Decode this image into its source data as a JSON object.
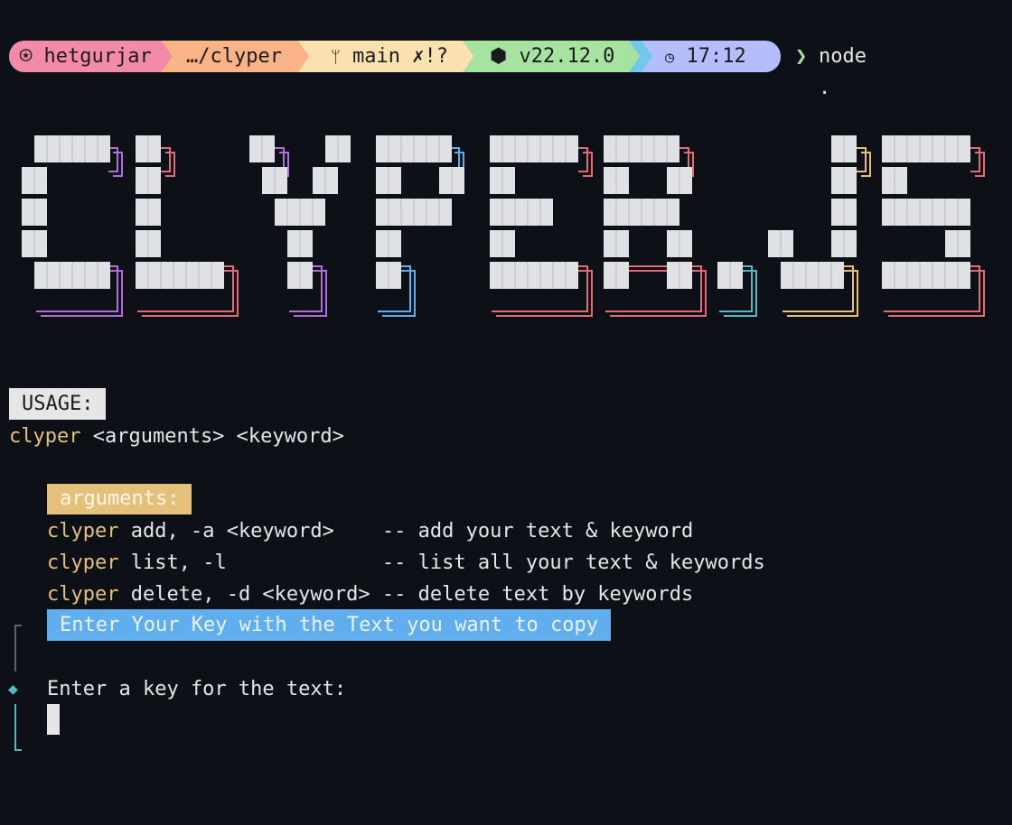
{
  "prompt": {
    "user_icon": "arch-icon",
    "user": "hetgurjar",
    "path": "…/clyper",
    "git_icon": "branch-icon",
    "git_branch": "main",
    "git_status": "✗!?",
    "node_icon": "node-icon",
    "node_version": "v22.12.0",
    "time_icon": "clock-icon",
    "time": "17:12",
    "prompt_char": "❯",
    "command": "node ."
  },
  "banner": {
    "text": "CLYPER.JS"
  },
  "usage": {
    "label": "USAGE:",
    "cmd": "clyper",
    "syntax": "<arguments> <keyword>"
  },
  "arguments": {
    "label": "arguments:",
    "rows": [
      {
        "cmd": "clyper",
        "args": "add, -a <keyword>    ",
        "desc": "-- add your text & keyword"
      },
      {
        "cmd": "clyper",
        "args": "list, -l             ",
        "desc": "-- list all your text & keywords"
      },
      {
        "cmd": "clyper",
        "args": "delete, -d <keyword> ",
        "desc": "-- delete text by keywords"
      }
    ]
  },
  "input_prompt": {
    "banner": "Enter Your Key with the Text you want to copy",
    "question": "Enter a key for the text:",
    "value": ""
  },
  "colors": {
    "background": "#0d1117",
    "user": "#f38ba8",
    "path": "#fab387",
    "git": "#f9e2af",
    "node": "#a6e3a1",
    "time": "#b4befe",
    "accent_yellow": "#e5c07b",
    "accent_blue": "#61aeee",
    "accent_cyan": "#56b6c2"
  }
}
